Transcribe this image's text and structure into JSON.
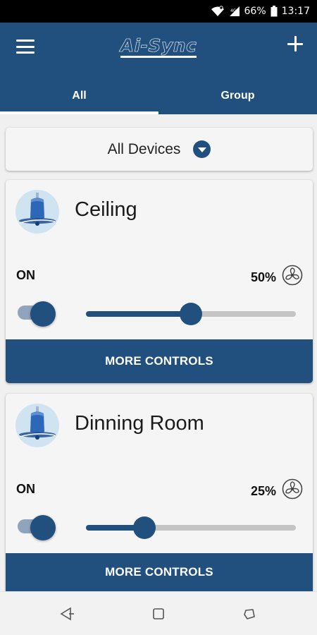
{
  "status_bar": {
    "battery": "66%",
    "time": "13:17"
  },
  "app_bar": {
    "logo": "Ai-Sync",
    "menu_icon": "hamburger-menu-icon",
    "add_icon": "plus-icon"
  },
  "tabs": [
    {
      "label": "All",
      "active": true
    },
    {
      "label": "Group",
      "active": false
    }
  ],
  "filter": {
    "selected": "All Devices",
    "icon": "dropdown-icon"
  },
  "devices": [
    {
      "name": "Ceiling",
      "state_label": "ON",
      "on": true,
      "speed": "50%",
      "speed_fraction": 0.5,
      "more_label": "MORE CONTROLS"
    },
    {
      "name": "Dinning Room",
      "state_label": "ON",
      "on": true,
      "speed": "25%",
      "speed_fraction": 0.25,
      "more_label": "MORE CONTROLS"
    }
  ],
  "colors": {
    "primary": "#21507e",
    "background": "#f0f0f0",
    "card": "#f5f5f5",
    "track_inactive": "#c4c4c4"
  },
  "nav_bar": {
    "back_icon": "back-triangle-icon",
    "home_icon": "home-square-icon",
    "recents_icon": "recents-icon"
  }
}
